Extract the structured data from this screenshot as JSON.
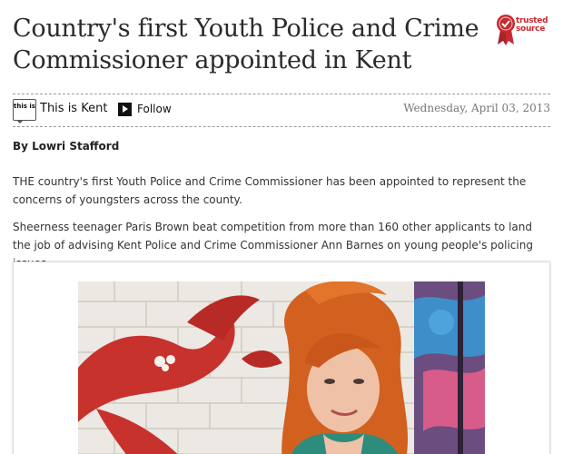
{
  "article": {
    "headline": "Country's first Youth Police and Crime Commissioner appointed in Kent",
    "byline": "By Lowri Stafford",
    "date": "Wednesday, April 03, 2013",
    "paragraphs": [
      "THE country's first Youth Police and Crime Commissioner has been appointed to represent the concerns of youngsters across the county.",
      "Sheerness teenager Paris Brown beat competition from more than 160 other applicants to land the job of advising Kent Police and Crime Commissioner Ann Barnes on young people's policing issues."
    ]
  },
  "badge": {
    "line1": "trusted",
    "line2": "source",
    "icon": "rosette-icon",
    "color": "#c62a2f"
  },
  "source": {
    "logo_text": "this is",
    "name": "This is Kent",
    "follow_label": "Follow",
    "follow_icon": "play-icon"
  },
  "photo": {
    "subject": "photo-of-young-woman-with-red-hair-before-mural"
  }
}
